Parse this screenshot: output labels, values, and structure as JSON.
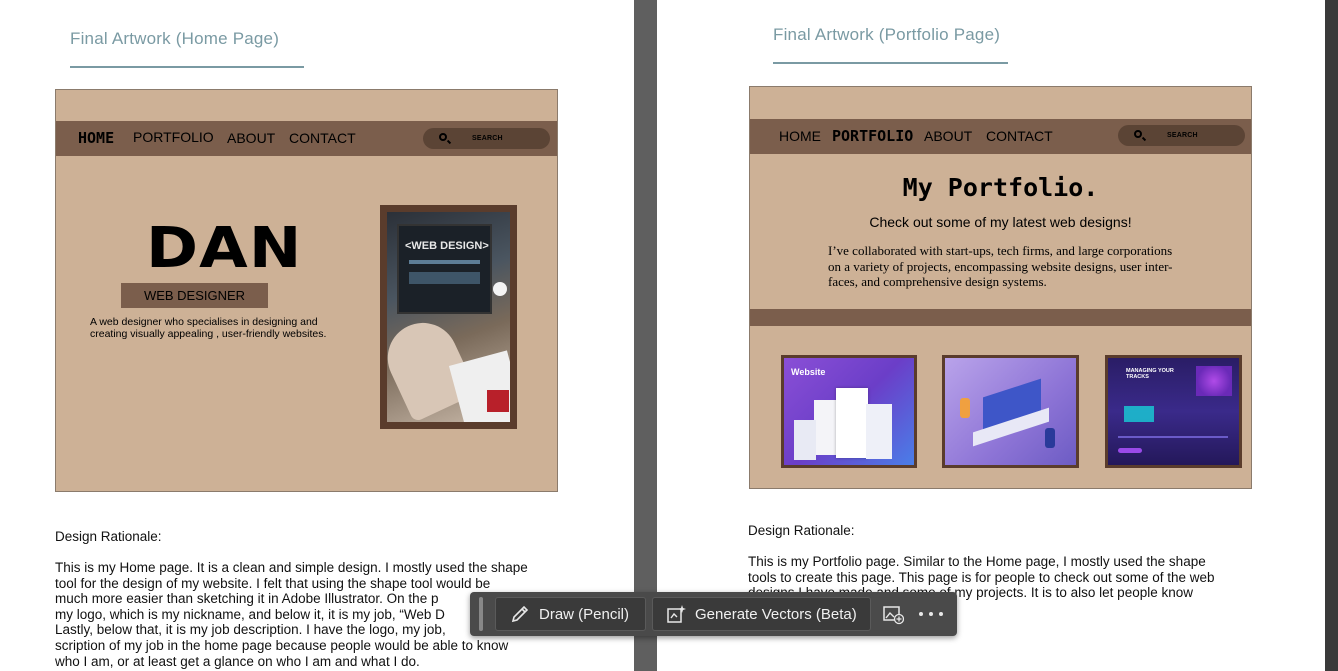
{
  "left_page": {
    "heading": "Final Artwork (Home Page)",
    "mock": {
      "nav": {
        "home": "HOME",
        "portfolio": "PORTFOLIO",
        "about": "ABOUT",
        "contact": "CONTACT",
        "search": "SEARCH"
      },
      "logo": "DAN",
      "job_title": "WEB DESIGNER",
      "description_line1": "A web designer who specialises in designing and",
      "description_line2": "creating visually appealing , user-friendly websites.",
      "photo_caption": "<WEB DESIGN>"
    },
    "rationale_label": "Design Rationale:",
    "rationale_lines": [
      "This is my Home page. It is a clean and simple design. I mostly used the shape",
      "tool for the design of my website. I felt that using the shape tool would be",
      "much more easier than sketching it in Adobe Illustrator. On the p",
      "my logo, which is my nickname, and below it, it is my job, “Web D",
      "Lastly, below that, it is my job description. I have the logo, my job,",
      "scription of my job in the home page because people would be able to know",
      "who I am, or at least get a glance on who I am and what I do."
    ]
  },
  "right_page": {
    "heading": "Final Artwork (Portfolio Page)",
    "mock": {
      "nav": {
        "home": "HOME",
        "portfolio": "PORTFOLIO",
        "about": "ABOUT",
        "contact": "CONTACT",
        "search": "SEARCH"
      },
      "title": "My Portfolio.",
      "subtitle": "Check out some of my latest web designs!",
      "intro_lines": [
        "I’ve collaborated with start-ups, tech firms, and large corporations",
        "on a variety of projects, encompassing website designs, user inter-",
        "faces, and comprehensive design systems."
      ],
      "thumb1_label": "Website",
      "thumb3_label": "MANAGING YOUR TRACKS"
    },
    "rationale_label": "Design Rationale:",
    "rationale_lines": [
      "This is my Portfolio page. Similar to the Home page, I mostly used the shape",
      "tools to create this page. This page is for people to check out some of the web",
      "designs I have made and some of my projects. It is to also let people know"
    ]
  },
  "toolbar": {
    "draw_label": "Draw (Pencil)",
    "generate_label": "Generate Vectors (Beta)",
    "icons": [
      "pencil-icon",
      "generate-vectors-icon",
      "image-add-icon",
      "more-icon"
    ]
  },
  "colors": {
    "mock_bg": "#cdb196",
    "nav_bg": "#7b5e4c",
    "heading": "#7a9aa3",
    "toolbar_bg": "#4a4a4a"
  }
}
